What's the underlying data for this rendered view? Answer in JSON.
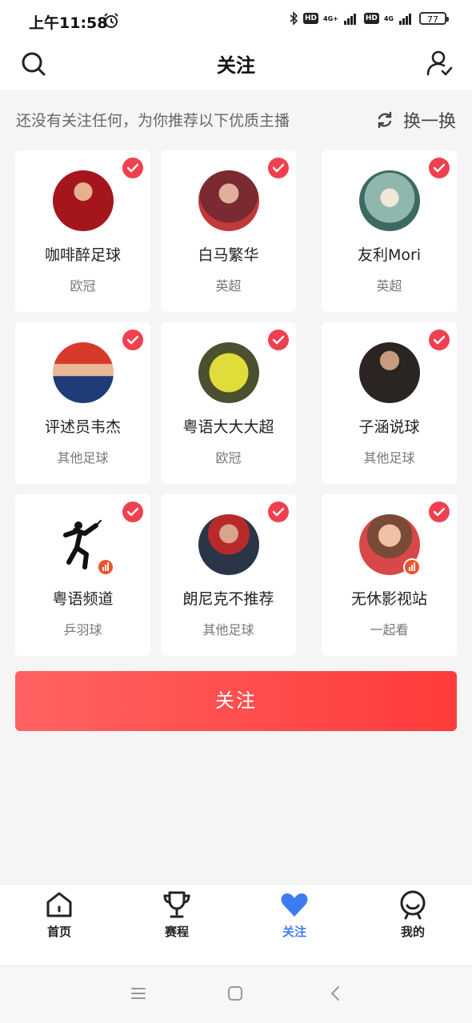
{
  "status": {
    "time": "上午11:58",
    "net1": "4G+",
    "net2": "4G",
    "hd": "HD",
    "battery": "77"
  },
  "header": {
    "title": "关注"
  },
  "recommend": {
    "text": "还没有关注任何，为你推荐以下优质主播",
    "refresh_label": "换一换"
  },
  "cards": [
    {
      "name": "咖啡醉足球",
      "category": "欧冠",
      "live": false,
      "avatar_bg": "#a5161c"
    },
    {
      "name": "白马繁华",
      "category": "英超",
      "live": false,
      "avatar_bg": "#8c5a55"
    },
    {
      "name": "友利Mori",
      "category": "英超",
      "live": false,
      "avatar_bg": "#5a8a7a"
    },
    {
      "name": "评述员韦杰",
      "category": "其他足球",
      "live": false,
      "avatar_bg": "#1f3c78"
    },
    {
      "name": "粤语大大大超",
      "category": "欧冠",
      "live": false,
      "avatar_bg": "#c7c02a"
    },
    {
      "name": "子涵说球",
      "category": "其他足球",
      "live": false,
      "avatar_bg": "#4a3a30"
    },
    {
      "name": "粤语频道",
      "category": "乒羽球",
      "live": true,
      "avatar_bg": "#ffffff"
    },
    {
      "name": "朗尼克不推荐",
      "category": "其他足球",
      "live": false,
      "avatar_bg": "#2b3548"
    },
    {
      "name": "无休影视站",
      "category": "一起看",
      "live": true,
      "avatar_bg": "#c98a78"
    }
  ],
  "follow_button": "关注",
  "tabs": [
    {
      "label": "首页",
      "icon": "home-icon",
      "active": false
    },
    {
      "label": "赛程",
      "icon": "trophy-icon",
      "active": false
    },
    {
      "label": "关注",
      "icon": "heart-icon",
      "active": true
    },
    {
      "label": "我的",
      "icon": "profile-icon",
      "active": false
    }
  ],
  "colors": {
    "accent": "#ff4444",
    "check": "#f0404f",
    "tab_active": "#3d7bf0"
  }
}
